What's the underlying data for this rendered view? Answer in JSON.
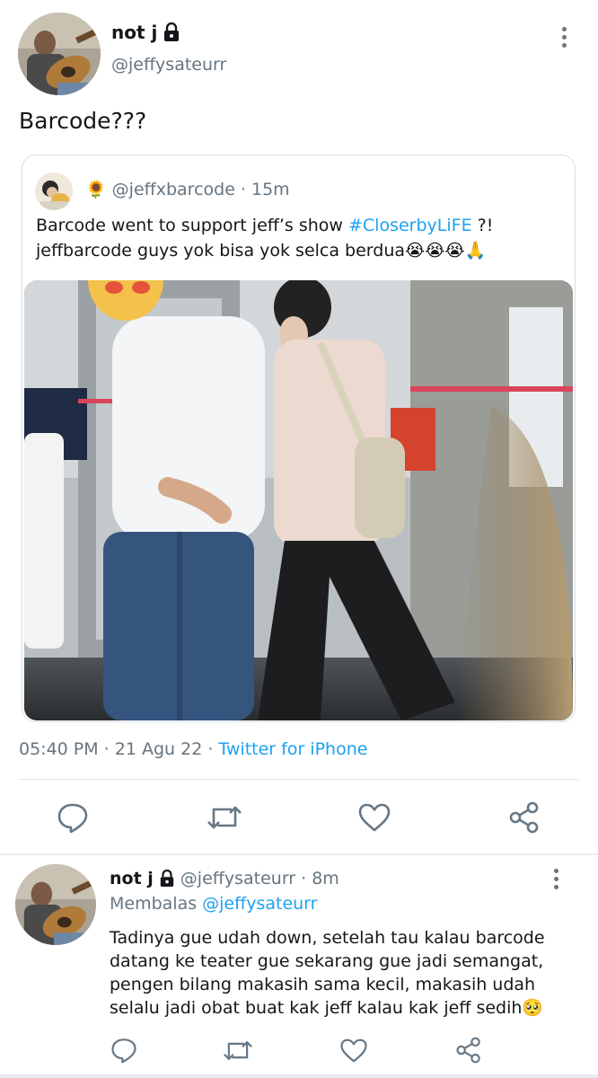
{
  "main_tweet": {
    "display_name": "not j",
    "handle": "@jeffysateurr",
    "text": "Barcode???",
    "timestamp": "05:40 PM · 21 Agu 22 · ",
    "source": "Twitter for iPhone"
  },
  "quoted_tweet": {
    "emoji": "🌻",
    "handle": "@jeffxbarcode",
    "age": "· 15m",
    "text_before_tag": "Barcode went to support jeff’s show ",
    "hashtag": "#CloserbyLiFE",
    "text_after_tag": " ?!",
    "text_line2": "jeffbarcode guys yok bisa yok selca berdua😭😭😭🙏"
  },
  "reply": {
    "display_name": "not j",
    "handle": "@jeffysateurr",
    "age": "· 8m",
    "replying_label": "Membalas ",
    "replying_to": "@jeffysateurr",
    "text": "Tadinya gue udah down, setelah tau kalau barcode datang ke teater gue sekarang gue jadi semangat, pengen bilang makasih sama kecil, makasih udah selalu jadi obat buat kak jeff kalau kak jeff sedih🥺"
  },
  "colors": {
    "link": "#1da1f2",
    "muted": "#66757f",
    "icon": "#657786",
    "divider": "#e1e8ed"
  },
  "icons": [
    "lock-icon",
    "more-vertical-icon",
    "reply-icon",
    "retweet-icon",
    "like-icon",
    "share-icon"
  ]
}
